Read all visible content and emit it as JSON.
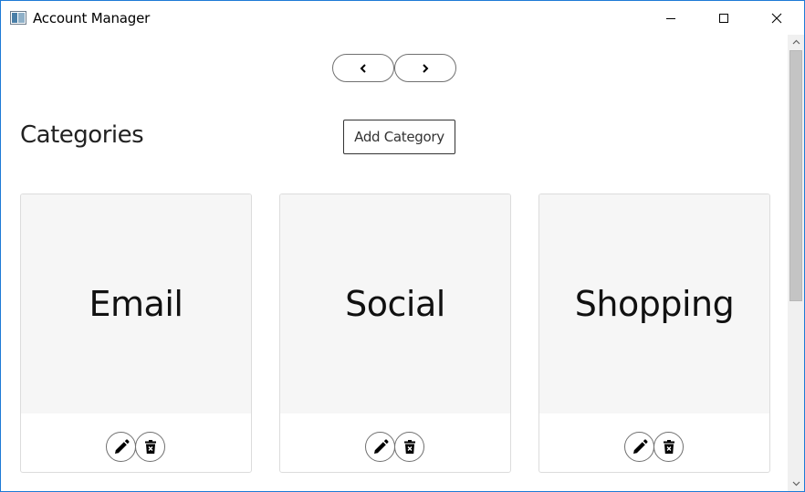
{
  "window": {
    "title": "Account Manager",
    "accent_color": "#1e7ad6"
  },
  "pager": {
    "prev_label": "<",
    "next_label": ">"
  },
  "header": {
    "title": "Categories",
    "add_button_label": "Add Category"
  },
  "categories": [
    {
      "name": "Email"
    },
    {
      "name": "Social"
    },
    {
      "name": "Shopping"
    }
  ],
  "icons": {
    "edit": "pencil-icon",
    "delete": "trash-icon"
  }
}
